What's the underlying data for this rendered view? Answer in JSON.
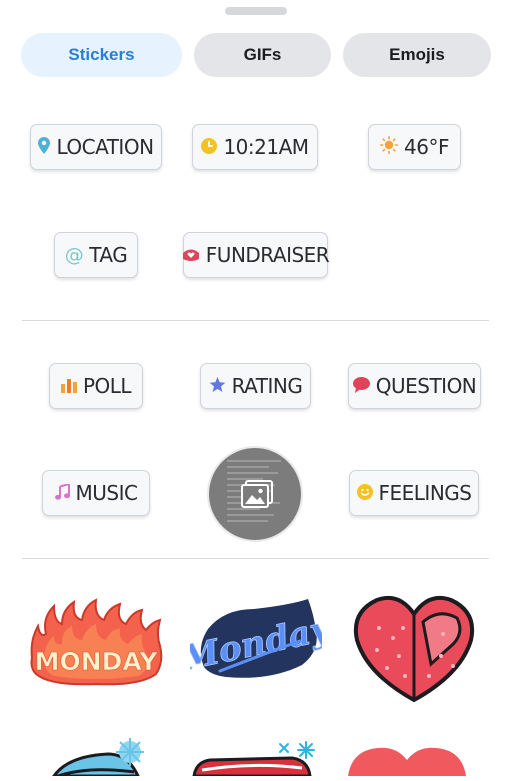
{
  "tabs": [
    {
      "label": "Stickers",
      "active": true
    },
    {
      "label": "GIFs",
      "active": false
    },
    {
      "label": "Emojis",
      "active": false
    }
  ],
  "stickers_row1": {
    "location": {
      "label": "LOCATION",
      "icon": "location-pin-icon"
    },
    "time": {
      "label": "10:21AM",
      "icon": "clock-icon"
    },
    "weather": {
      "label": "46°F",
      "icon": "sun-icon"
    }
  },
  "stickers_row2": {
    "tag": {
      "label": "TAG",
      "icon": "at-sign-icon"
    },
    "fundraiser": {
      "label": "FUNDRAISER",
      "icon": "donation-icon"
    }
  },
  "stickers_row3": {
    "poll": {
      "label": "POLL",
      "icon": "bar-chart-icon"
    },
    "rating": {
      "label": "RATING",
      "icon": "star-icon"
    },
    "question": {
      "label": "QUESTION",
      "icon": "speech-bubble-icon"
    }
  },
  "stickers_row4": {
    "music": {
      "label": "MUSIC",
      "icon": "music-note-icon"
    },
    "media": {
      "icon": "photo-gallery-icon"
    },
    "feelings": {
      "label": "FEELINGS",
      "icon": "smile-icon"
    }
  },
  "art_stickers": {
    "monday_fire": "MONDAY",
    "monday_script": "Monday"
  },
  "colors": {
    "accent": "#2a7fd5",
    "tab_active_bg": "#e6f2fd",
    "tab_bg": "#e4e5e9",
    "chip_border": "#cfd3da"
  }
}
